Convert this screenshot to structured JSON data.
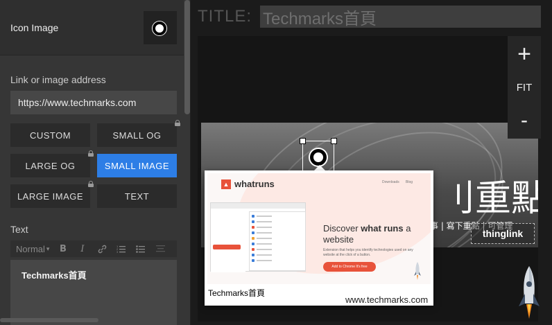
{
  "sidebar": {
    "icon_image_label": "Icon Image",
    "link_label": "Link or image address",
    "link_value": "https://www.techmarks.com",
    "size_buttons": [
      "CUSTOM",
      "SMALL OG",
      "LARGE OG",
      "SMALL IMAGE",
      "LARGE IMAGE",
      "TEXT"
    ],
    "selected_size": "SMALL IMAGE",
    "text_label": "Text",
    "format_value": "Normal",
    "text_content": "Techmarks首頁"
  },
  "editor": {
    "title_label": "TITLE:",
    "title_value": "Techmarks首頁"
  },
  "canvas": {
    "headline": "刂重點",
    "subline": "事 | 寫下重點 | 可管理",
    "badge": "thinglink"
  },
  "zoom": {
    "in": "+",
    "fit": "FIT",
    "out": "-"
  },
  "popup": {
    "brand": "whatruns",
    "nav_downloads": "Downloads",
    "nav_blog": "Blog",
    "heading_pre": "Discover ",
    "heading_strong": "what runs",
    "heading_post": " a website",
    "description": "Extension that helps you identify technologies used on any website at the click of a button.",
    "cta": "Add to Chrome  It's free",
    "title": "Techmarks首頁",
    "url": "www.techmarks.com"
  },
  "colors": {
    "accent": "#2d7ee6",
    "brand": "#e8523a"
  }
}
